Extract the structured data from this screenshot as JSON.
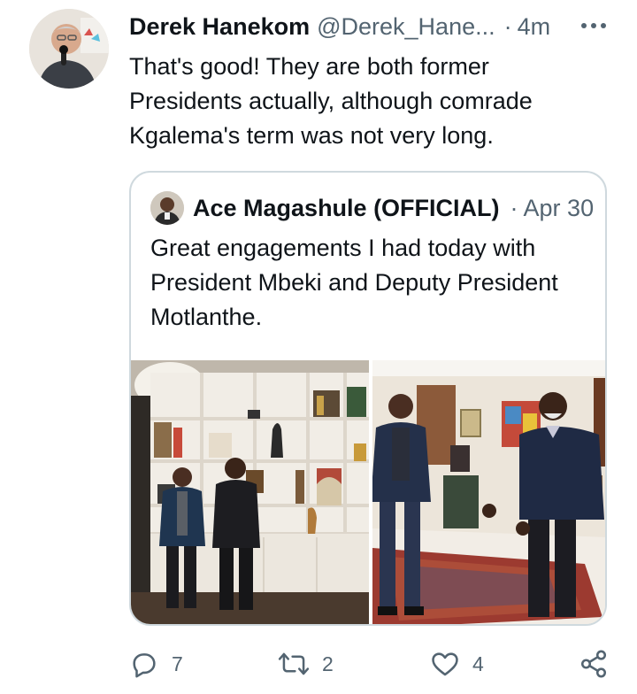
{
  "tweet": {
    "author_name": "Derek Hanekom",
    "author_handle": "@Derek_Hane...",
    "separator": "·",
    "time": "4m",
    "text": "That's good! They are both former Presidents actually, although comrade Kgalema's term was not very long."
  },
  "quoted_tweet": {
    "author_name": "Ace Magashule (OFFICIAL)",
    "separator": "·",
    "time": "Apr 30",
    "text": "Great engagements I had today with President Mbeki and Deputy President Motlanthe."
  },
  "actions": {
    "reply_count": "7",
    "retweet_count": "2",
    "like_count": "4"
  },
  "icons": {
    "reply": "reply-icon",
    "retweet": "retweet-icon",
    "like": "heart-icon",
    "share": "share-icon",
    "more": "more-icon"
  },
  "colors": {
    "text_primary": "#0f1419",
    "text_secondary": "#536471",
    "border": "#cfd9de"
  }
}
